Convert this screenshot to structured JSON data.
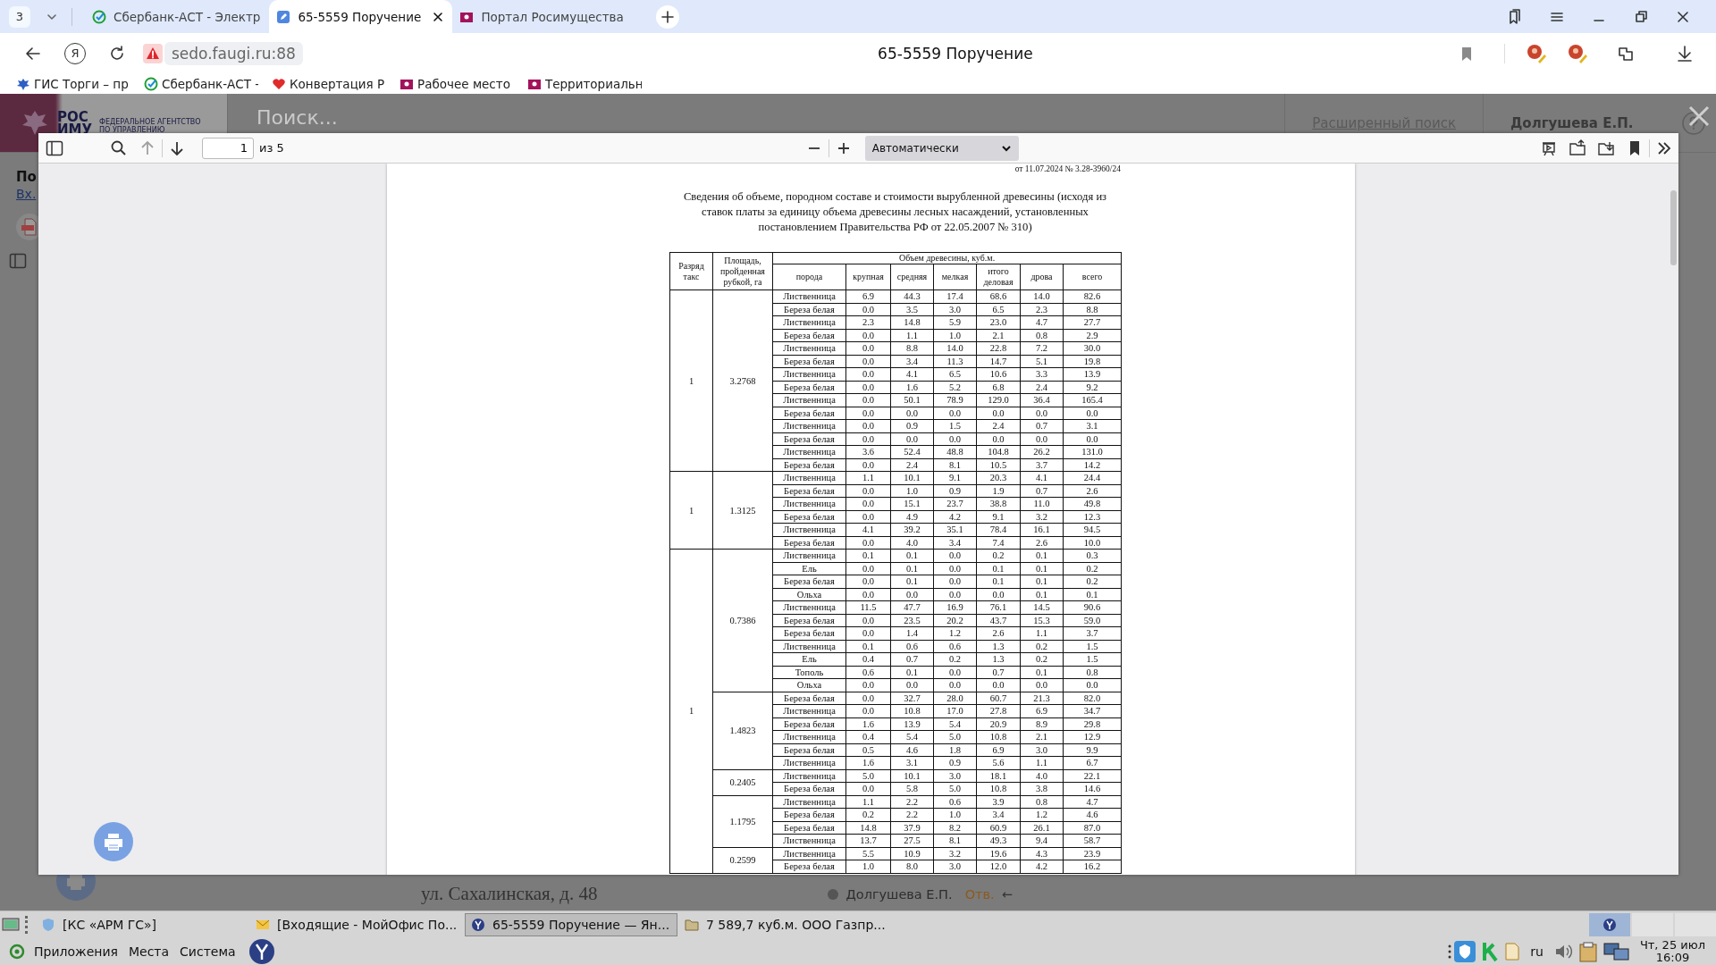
{
  "browser": {
    "tab_count": "3",
    "tabs": [
      {
        "title": "Сбербанк-АСТ - Электр",
        "kind": "sber",
        "selected": false
      },
      {
        "title": "65-5559 Поручение",
        "kind": "doc",
        "selected": true
      },
      {
        "title": "Портал Росимущества",
        "kind": "flag",
        "selected": false
      }
    ],
    "home_glyph": "Я",
    "address": "sedo.faugi.ru:88",
    "page_title": "65-5559 Поручение",
    "bookmarks": [
      {
        "title": "ГИС Торги – пр",
        "kind": "eagle"
      },
      {
        "title": "Сбербанк-АСТ -",
        "kind": "sber"
      },
      {
        "title": "Конвертация Р",
        "kind": "heart"
      },
      {
        "title": "Рабочее место",
        "kind": "flag"
      },
      {
        "title": "Территориальн",
        "kind": "flag"
      }
    ]
  },
  "background_page": {
    "logo_lines": [
      "РОС",
      "ИМУ"
    ],
    "agency_lines": [
      "ФЕДЕРАЛЬНОЕ АГЕНТСТВО",
      "ПО УПРАВЛЕНИЮ"
    ],
    "search_placeholder": "Поиск...",
    "advanced_search": "Расширенный поиск",
    "user": "Долгушева Е.П.",
    "heading": "По",
    "link": "Вх.",
    "address_line": "ул. Сахалинская, д. 48",
    "assignee": "Долгушева Е.П.",
    "assignee_role": "Отв.",
    "arrow": "←"
  },
  "pdf_viewer": {
    "page_number": "1",
    "page_count": "из 5",
    "zoom": "Автоматически",
    "document": {
      "reference": "от 11.07.2024 № 3.28-3960/24",
      "title": "Сведения об объеме, породном составе и стоимости вырубленной древесины (исходя из ставок платы за единицу объема древесины лесных насаждений, установленных постановлением Правительства РФ от 22.05.2007 № 310)",
      "table": {
        "column_rank": "Разряд такс",
        "column_area": "Площадь, пройденная рубкой, га",
        "volume_group": "Объем древесины, куб.м.",
        "columns": [
          "порода",
          "крупная",
          "средняя",
          "мелкая",
          "итого деловая",
          "дрова",
          "всего"
        ],
        "groups": [
          {
            "rank": "1",
            "areas": [
              {
                "area": "3.2768",
                "rows": [
                  [
                    "Лиственница",
                    "6.9",
                    "44.3",
                    "17.4",
                    "68.6",
                    "14.0",
                    "82.6"
                  ],
                  [
                    "Береза белая",
                    "0.0",
                    "3.5",
                    "3.0",
                    "6.5",
                    "2.3",
                    "8.8"
                  ],
                  [
                    "Лиственница",
                    "2.3",
                    "14.8",
                    "5.9",
                    "23.0",
                    "4.7",
                    "27.7"
                  ],
                  [
                    "Береза белая",
                    "0.0",
                    "1.1",
                    "1.0",
                    "2.1",
                    "0.8",
                    "2.9"
                  ],
                  [
                    "Лиственница",
                    "0.0",
                    "8.8",
                    "14.0",
                    "22.8",
                    "7.2",
                    "30.0"
                  ],
                  [
                    "Береза белая",
                    "0.0",
                    "3.4",
                    "11.3",
                    "14.7",
                    "5.1",
                    "19.8"
                  ],
                  [
                    "Лиственница",
                    "0.0",
                    "4.1",
                    "6.5",
                    "10.6",
                    "3.3",
                    "13.9"
                  ],
                  [
                    "Береза белая",
                    "0.0",
                    "1.6",
                    "5.2",
                    "6.8",
                    "2.4",
                    "9.2"
                  ],
                  [
                    "Лиственница",
                    "0.0",
                    "50.1",
                    "78.9",
                    "129.0",
                    "36.4",
                    "165.4"
                  ],
                  [
                    "Береза белая",
                    "0.0",
                    "0.0",
                    "0.0",
                    "0.0",
                    "0.0",
                    "0.0"
                  ],
                  [
                    "Лиственница",
                    "0.0",
                    "0.9",
                    "1.5",
                    "2.4",
                    "0.7",
                    "3.1"
                  ],
                  [
                    "Береза белая",
                    "0.0",
                    "0.0",
                    "0.0",
                    "0.0",
                    "0.0",
                    "0.0"
                  ],
                  [
                    "Лиственница",
                    "3.6",
                    "52.4",
                    "48.8",
                    "104.8",
                    "26.2",
                    "131.0"
                  ],
                  [
                    "Береза белая",
                    "0.0",
                    "2.4",
                    "8.1",
                    "10.5",
                    "3.7",
                    "14.2"
                  ]
                ]
              }
            ]
          },
          {
            "rank": "1",
            "areas": [
              {
                "area": "1.3125",
                "rows": [
                  [
                    "Лиственница",
                    "1.1",
                    "10.1",
                    "9.1",
                    "20.3",
                    "4.1",
                    "24.4"
                  ],
                  [
                    "Береза белая",
                    "0.0",
                    "1.0",
                    "0.9",
                    "1.9",
                    "0.7",
                    "2.6"
                  ],
                  [
                    "Лиственница",
                    "0.0",
                    "15.1",
                    "23.7",
                    "38.8",
                    "11.0",
                    "49.8"
                  ],
                  [
                    "Береза белая",
                    "0.0",
                    "4.9",
                    "4.2",
                    "9.1",
                    "3.2",
                    "12.3"
                  ],
                  [
                    "Лиственница",
                    "4.1",
                    "39.2",
                    "35.1",
                    "78.4",
                    "16.1",
                    "94.5"
                  ],
                  [
                    "Береза белая",
                    "0.0",
                    "4.0",
                    "3.4",
                    "7.4",
                    "2.6",
                    "10.0"
                  ]
                ]
              }
            ]
          },
          {
            "rank": "1",
            "areas": [
              {
                "area": "0.7386",
                "rows": [
                  [
                    "Лиственница",
                    "0.1",
                    "0.1",
                    "0.0",
                    "0.2",
                    "0.1",
                    "0.3"
                  ],
                  [
                    "Ель",
                    "0.0",
                    "0.1",
                    "0.0",
                    "0.1",
                    "0.1",
                    "0.2"
                  ],
                  [
                    "Береза белая",
                    "0.0",
                    "0.1",
                    "0.0",
                    "0.1",
                    "0.1",
                    "0.2"
                  ],
                  [
                    "Ольха",
                    "0.0",
                    "0.0",
                    "0.0",
                    "0.0",
                    "0.1",
                    "0.1"
                  ],
                  [
                    "Лиственница",
                    "11.5",
                    "47.7",
                    "16.9",
                    "76.1",
                    "14.5",
                    "90.6"
                  ],
                  [
                    "Береза белая",
                    "0.0",
                    "23.5",
                    "20.2",
                    "43.7",
                    "15.3",
                    "59.0"
                  ],
                  [
                    "Береза белая",
                    "0.0",
                    "1.4",
                    "1.2",
                    "2.6",
                    "1.1",
                    "3.7"
                  ],
                  [
                    "Лиственница",
                    "0.1",
                    "0.6",
                    "0.6",
                    "1.3",
                    "0.2",
                    "1.5"
                  ],
                  [
                    "Ель",
                    "0.4",
                    "0.7",
                    "0.2",
                    "1.3",
                    "0.2",
                    "1.5"
                  ],
                  [
                    "Тополь",
                    "0.6",
                    "0.1",
                    "0.0",
                    "0.7",
                    "0.1",
                    "0.8"
                  ],
                  [
                    "Ольха",
                    "0.0",
                    "0.0",
                    "0.0",
                    "0.0",
                    "0.0",
                    "0.0"
                  ]
                ]
              },
              {
                "area": "1.4823",
                "rows": [
                  [
                    "Береза белая",
                    "0.0",
                    "32.7",
                    "28.0",
                    "60.7",
                    "21.3",
                    "82.0"
                  ],
                  [
                    "Лиственница",
                    "0.0",
                    "10.8",
                    "17.0",
                    "27.8",
                    "6.9",
                    "34.7"
                  ],
                  [
                    "Береза белая",
                    "1.6",
                    "13.9",
                    "5.4",
                    "20.9",
                    "8.9",
                    "29.8"
                  ],
                  [
                    "Лиственница",
                    "0.4",
                    "5.4",
                    "5.0",
                    "10.8",
                    "2.1",
                    "12.9"
                  ],
                  [
                    "Береза белая",
                    "0.5",
                    "4.6",
                    "1.8",
                    "6.9",
                    "3.0",
                    "9.9"
                  ],
                  [
                    "Лиственница",
                    "1.6",
                    "3.1",
                    "0.9",
                    "5.6",
                    "1.1",
                    "6.7"
                  ]
                ]
              },
              {
                "area": "0.2405",
                "rows": [
                  [
                    "Лиственница",
                    "5.0",
                    "10.1",
                    "3.0",
                    "18.1",
                    "4.0",
                    "22.1"
                  ],
                  [
                    "Береза белая",
                    "0.0",
                    "5.8",
                    "5.0",
                    "10.8",
                    "3.8",
                    "14.6"
                  ]
                ]
              },
              {
                "area": "1.1795",
                "rows": [
                  [
                    "Лиственница",
                    "1.1",
                    "2.2",
                    "0.6",
                    "3.9",
                    "0.8",
                    "4.7"
                  ],
                  [
                    "Береза белая",
                    "0.2",
                    "2.2",
                    "1.0",
                    "3.4",
                    "1.2",
                    "4.6"
                  ],
                  [
                    "Береза белая",
                    "14.8",
                    "37.9",
                    "8.2",
                    "60.9",
                    "26.1",
                    "87.0"
                  ],
                  [
                    "Лиственница",
                    "13.7",
                    "27.5",
                    "8.1",
                    "49.3",
                    "9.4",
                    "58.7"
                  ]
                ]
              },
              {
                "area": "0.2599",
                "rows": [
                  [
                    "Лиственница",
                    "5.5",
                    "10.9",
                    "3.2",
                    "19.6",
                    "4.3",
                    "23.9"
                  ],
                  [
                    "Береза белая",
                    "1.0",
                    "8.0",
                    "3.0",
                    "12.0",
                    "4.2",
                    "16.2"
                  ]
                ]
              }
            ]
          }
        ]
      }
    }
  },
  "taskbar": {
    "windows": [
      {
        "title": "[КС «АРМ ГС»]",
        "kind": "app",
        "selected": false
      },
      {
        "title": "[Входящие - МойОфис По...",
        "kind": "mail",
        "selected": false
      },
      {
        "title": "65-5559 Поручение — Ян...",
        "kind": "browser",
        "selected": true
      },
      {
        "title": "7 589,7 куб.м. ООО Газпр...",
        "kind": "folder",
        "selected": false
      }
    ],
    "menus": [
      "Приложения",
      "Места",
      "Система"
    ],
    "language": "ru",
    "date": "Чт, 25 июл",
    "time": "16:09"
  }
}
